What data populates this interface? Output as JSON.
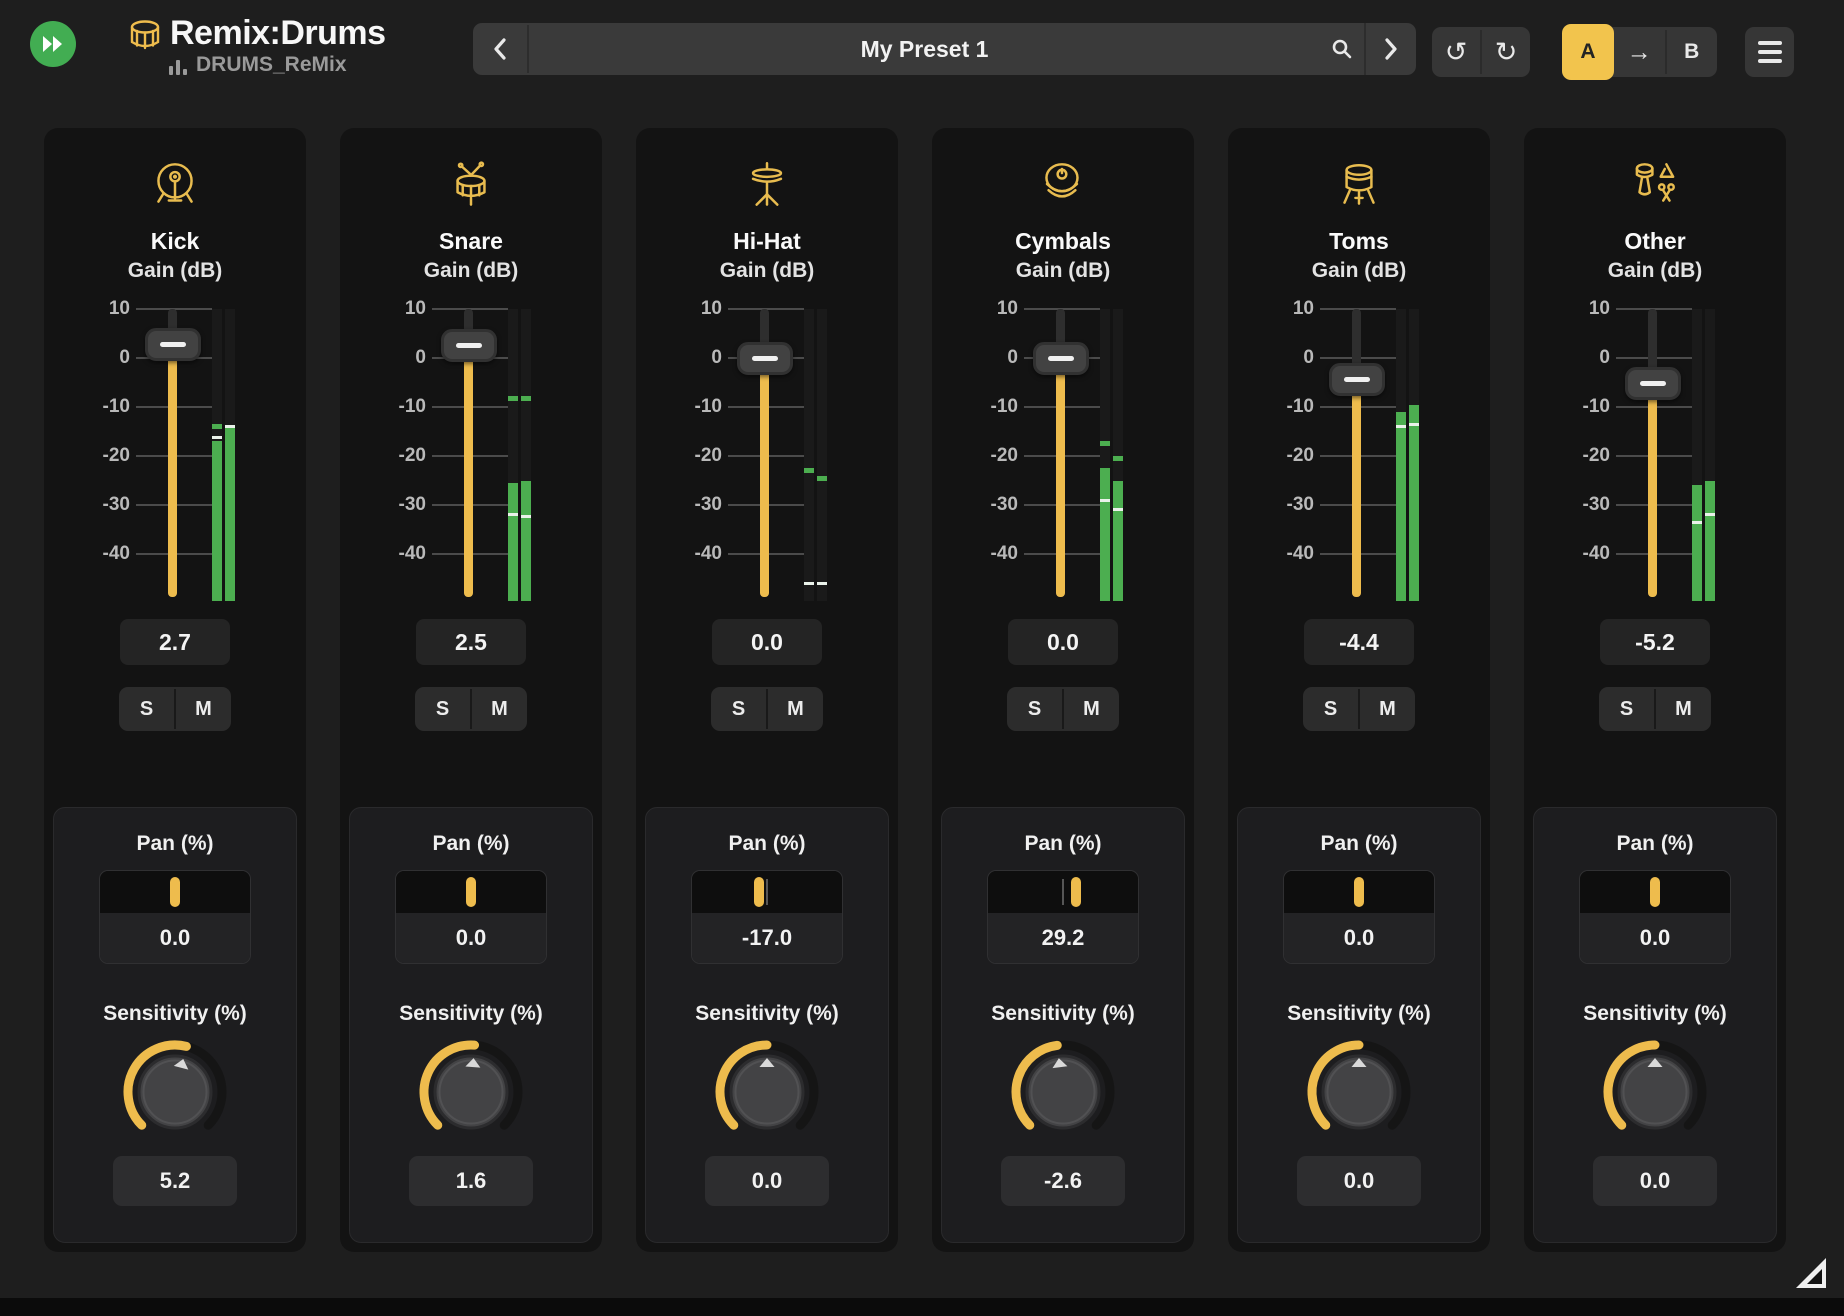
{
  "header": {
    "title": "Remix:Drums",
    "subtitle": "DRUMS_ReMix",
    "preset": {
      "value": "My Preset 1"
    },
    "ab": {
      "a_label": "A",
      "arrow": "→",
      "b_label": "B",
      "active": "A"
    },
    "undo_glyph": "↺",
    "redo_glyph": "↻"
  },
  "labels": {
    "gain": "Gain (dB)",
    "pan": "Pan (%)",
    "sensitivity": "Sensitivity (%)",
    "solo": "S",
    "mute": "M"
  },
  "colors": {
    "accent_yellow": "#eebc4d",
    "meter_green": "#4cae50",
    "logo_green": "#42ad52",
    "ab_active_yellow": "#f2c44d"
  },
  "fader_scale": [
    10,
    0,
    -10,
    -20,
    -30,
    -40
  ],
  "channels": [
    {
      "name": "Kick",
      "icon": "kick-drum-icon",
      "gain": "2.7",
      "gain_db": 2.7,
      "pan": "0.0",
      "pan_val": 0,
      "sensitivity": "5.2",
      "sens_val": 5.2,
      "meter": {
        "l": {
          "level": -17,
          "peak": -16.3,
          "hold": -13.9
        },
        "r": {
          "level": -14.2,
          "peak": -13.9,
          "hold": null
        }
      }
    },
    {
      "name": "Snare",
      "icon": "snare-drum-icon",
      "gain": "2.5",
      "gain_db": 2.5,
      "pan": "0.0",
      "pan_val": 0,
      "sensitivity": "1.6",
      "sens_val": 1.6,
      "meter": {
        "l": {
          "level": -25.5,
          "peak": -32,
          "hold": -8.2
        },
        "r": {
          "level": -25,
          "peak": -32.3,
          "hold": -8.2
        }
      }
    },
    {
      "name": "Hi-Hat",
      "icon": "hi-hat-icon",
      "gain": "0.0",
      "gain_db": 0,
      "pan": "-17.0",
      "pan_val": -17,
      "sensitivity": "0.0",
      "sens_val": 0,
      "meter": {
        "l": {
          "level": null,
          "peak": -46,
          "hold": -23
        },
        "r": {
          "level": null,
          "peak": -46,
          "hold": -24.5
        }
      }
    },
    {
      "name": "Cymbals",
      "icon": "cymbals-icon",
      "gain": "0.0",
      "gain_db": 0,
      "pan": "29.2",
      "pan_val": 29.2,
      "sensitivity": "-2.6",
      "sens_val": -2.6,
      "meter": {
        "l": {
          "level": -22.5,
          "peak": -29,
          "hold": -17.5
        },
        "r": {
          "level": -25,
          "peak": -31,
          "hold": -20.5
        }
      }
    },
    {
      "name": "Toms",
      "icon": "toms-icon",
      "gain": "-4.4",
      "gain_db": -4.4,
      "pan": "0.0",
      "pan_val": 0,
      "sensitivity": "0.0",
      "sens_val": 0,
      "meter": {
        "l": {
          "level": -11,
          "peak": -14,
          "hold": null
        },
        "r": {
          "level": -9.5,
          "peak": -13.5,
          "hold": null
        }
      }
    },
    {
      "name": "Other",
      "icon": "other-percussion-icon",
      "gain": "-5.2",
      "gain_db": -5.2,
      "pan": "0.0",
      "pan_val": 0,
      "sensitivity": "0.0",
      "sens_val": 0,
      "meter": {
        "l": {
          "level": -26,
          "peak": -33.5,
          "hold": null
        },
        "r": {
          "level": -25,
          "peak": -32,
          "hold": null
        }
      }
    }
  ]
}
